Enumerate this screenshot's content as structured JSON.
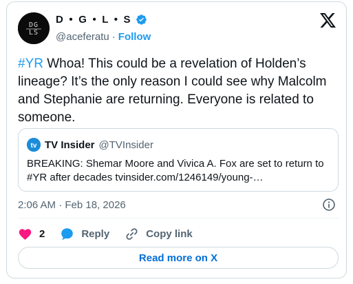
{
  "author": {
    "display_name": "D • G • L • S",
    "handle": "@aceferatu",
    "separator": "·",
    "follow_label": "Follow",
    "verified": true
  },
  "tweet": {
    "hashtag": "#YR",
    "text": " Whoa! This could be a revelation of Holden’s lineage? It’s the only reason I could see why Malcolm and Stephanie are returning. Everyone is related to someone.",
    "timestamp": "2:06 AM · Feb 18, 2026"
  },
  "quoted": {
    "name": "TV Insider",
    "handle": "@TVInsider",
    "text_prefix": "BREAKING: Shemar Moore and Vivica A. Fox are set to return to ",
    "hashtag": "#YR",
    "text_middle": " after decades ",
    "link": "tvinsider.com/1246149/young-…"
  },
  "actions": {
    "like_count": "2",
    "reply_label": "Reply",
    "copy_label": "Copy link"
  },
  "footer": {
    "read_more_label": "Read more on X"
  },
  "colors": {
    "accent": "#1d9bf0",
    "like_heart": "#f91880",
    "reply_bubble": "#1d9bf0",
    "read_more_text": "#006fd6",
    "border": "#cfd9de"
  },
  "icons": {
    "brand": "x-logo-icon",
    "verified": "verified-badge-icon",
    "info": "info-icon",
    "like": "heart-icon",
    "reply": "reply-bubble-icon",
    "copy": "link-icon"
  }
}
